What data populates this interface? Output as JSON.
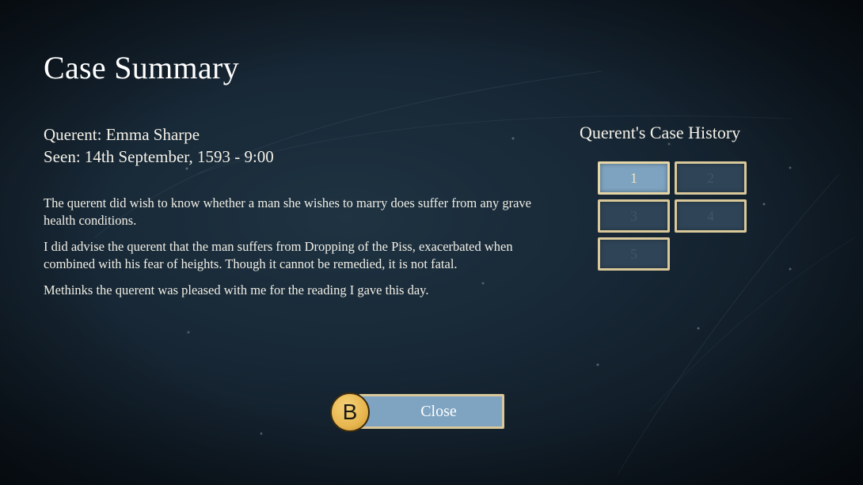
{
  "screen": {
    "title": "Case Summary"
  },
  "querent": {
    "name_line": "Querent: Emma Sharpe",
    "seen_line": "Seen: 14th September, 1593 - 9:00"
  },
  "summary": {
    "paragraphs": [
      "The querent did wish to know whether a man she wishes to marry does suffer from any grave health conditions.",
      "I did advise the querent that the man suffers from Dropping of the Piss, exacerbated when combined with his fear of heights. Though it cannot be remedied, it is not fatal.",
      "Methinks the querent was pleased with me for the reading I gave this day."
    ]
  },
  "history": {
    "title": "Querent's Case History",
    "cases": [
      {
        "label": "1",
        "active": true
      },
      {
        "label": "2",
        "active": false
      },
      {
        "label": "3",
        "active": false
      },
      {
        "label": "4",
        "active": false
      },
      {
        "label": "5",
        "active": false
      }
    ]
  },
  "actions": {
    "close_label": "Close",
    "close_key": "B"
  },
  "colors": {
    "accent_border": "#d9c89a",
    "active_tile": "#7ea3c0",
    "button_fill": "#7fa4c1",
    "badge": "#e7b64e"
  }
}
